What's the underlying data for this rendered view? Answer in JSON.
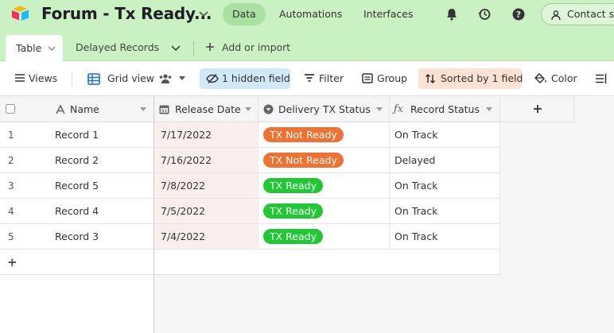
{
  "header": {
    "base_title": "Forum - Tx Ready...",
    "nav": [
      "Data",
      "Automations",
      "Interfaces"
    ],
    "contact_label": "Contact sa"
  },
  "tables_bar": {
    "active_tab": "Table",
    "other_tab": "Delayed Records",
    "add_import": "Add or import"
  },
  "view_bar": {
    "views": "Views",
    "grid_view": "Grid view",
    "hidden_field": "1 hidden field",
    "filter": "Filter",
    "group": "Group",
    "sorted": "Sorted by 1 field",
    "color": "Color"
  },
  "grid": {
    "columns": [
      "Name",
      "Release Date",
      "Delivery TX Status",
      "Record Status"
    ],
    "rows": [
      {
        "num": "1",
        "name": "Record 1",
        "date": "7/17/2022",
        "delivery": "TX Not Ready",
        "status": "On Track"
      },
      {
        "num": "2",
        "name": "Record 2",
        "date": "7/16/2022",
        "delivery": "TX Not Ready",
        "status": "Delayed"
      },
      {
        "num": "3",
        "name": "Record 5",
        "date": "7/8/2022",
        "delivery": "TX Ready",
        "status": "On Track"
      },
      {
        "num": "4",
        "name": "Record 4",
        "date": "7/5/2022",
        "delivery": "TX Ready",
        "status": "On Track"
      },
      {
        "num": "5",
        "name": "Record 3",
        "date": "7/4/2022",
        "delivery": "TX Ready",
        "status": "On Track"
      }
    ],
    "add_symbol": "+"
  },
  "colors": {
    "not_ready": "#f07232",
    "ready": "#20c933",
    "header_bg": "#c9f1c1"
  },
  "icons": [
    "airtable-logo-icon",
    "bell-icon",
    "history-icon",
    "help-icon",
    "user-add-icon",
    "chevron-down-icon",
    "plus-icon",
    "hamburger-icon",
    "grid-icon",
    "people-icon",
    "eye-slash-icon",
    "filter-icon",
    "group-icon",
    "sort-icon",
    "paint-bucket-icon",
    "row-height-icon",
    "text-field-icon",
    "calendar-icon",
    "single-select-icon",
    "formula-icon"
  ]
}
